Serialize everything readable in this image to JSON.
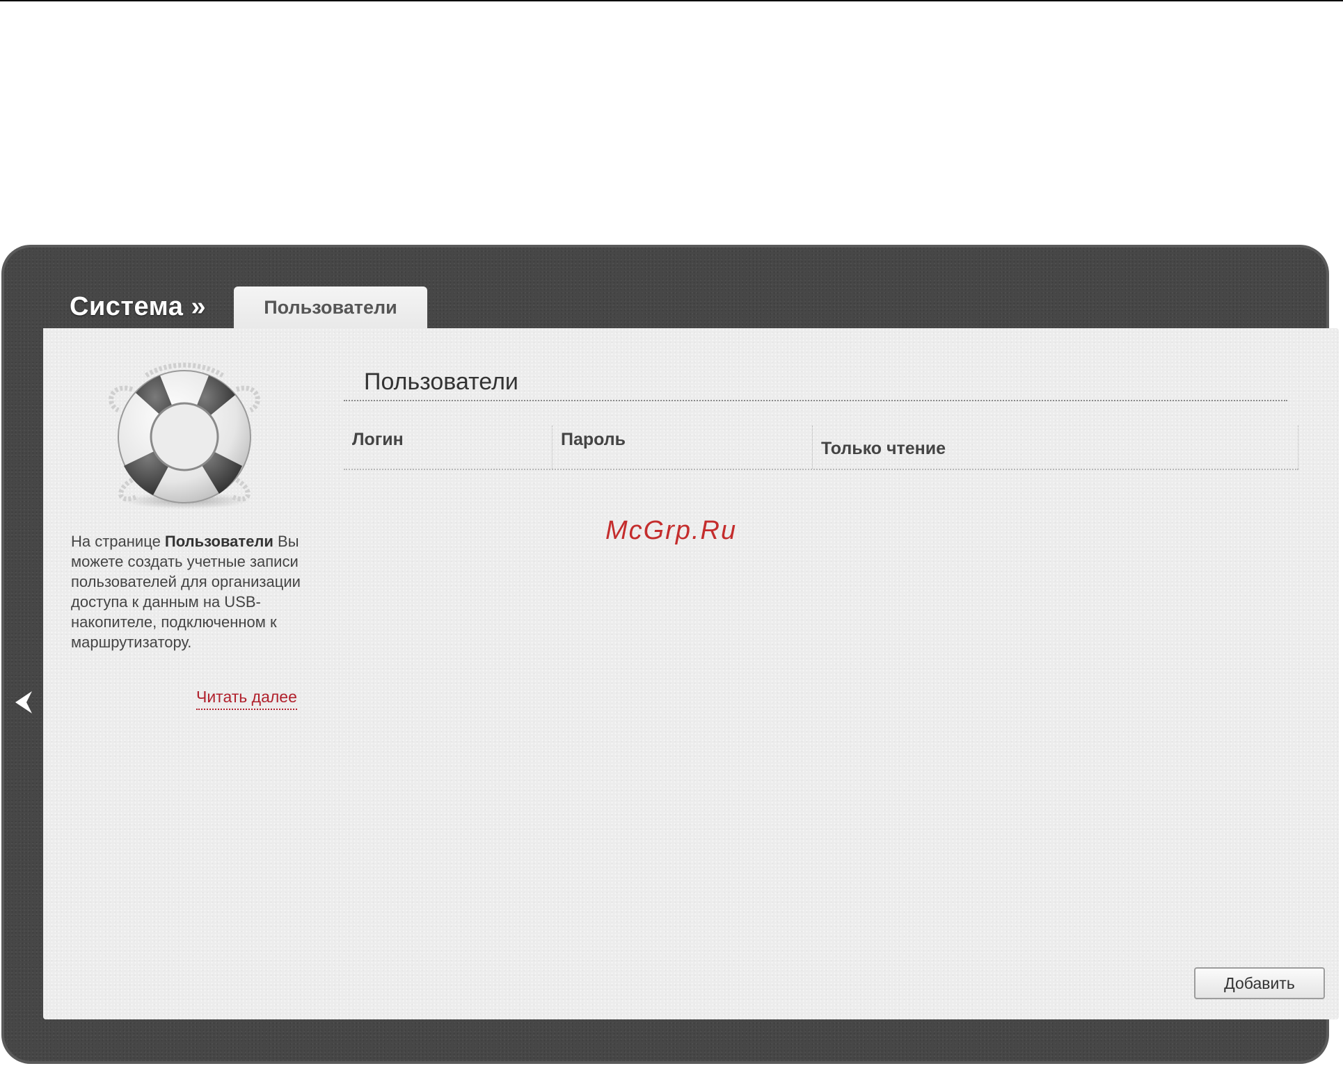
{
  "header": {
    "breadcrumb": "Система »",
    "active_tab": "Пользователи"
  },
  "sidebar": {
    "icon": "lifebuoy-icon",
    "help_prefix": "На странице ",
    "help_bold": "Пользователи",
    "help_body": " Вы можете создать учетные записи пользователей для организации доступа к данным на USB-накопителе, подключенном к маршрутизатору.",
    "read_more": "Читать далее"
  },
  "main": {
    "section_title": "Пользователи",
    "table": {
      "columns": [
        "Логин",
        "Пароль",
        "Только чтение"
      ],
      "rows": []
    },
    "add_button": "Добавить"
  },
  "watermark": "McGrp.Ru",
  "colors": {
    "frame": "#474747",
    "panel": "#ececec",
    "link": "#b0202c",
    "watermark": "#c42d2d"
  }
}
